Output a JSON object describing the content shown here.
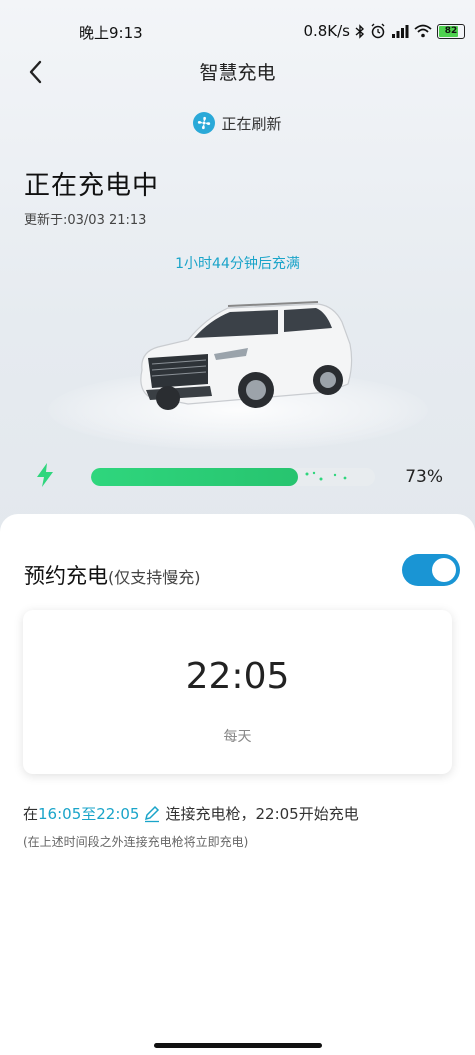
{
  "status_bar": {
    "time": "晚上9:13",
    "network_speed": "0.8K/s",
    "battery_level": "82",
    "battery_color": "#4fd14f",
    "icons": [
      "bluetooth-icon",
      "alarm-icon",
      "signal-icon",
      "wifi-icon",
      "battery-icon"
    ]
  },
  "header": {
    "title": "智慧充电",
    "back_icon": "chevron-left-icon"
  },
  "refresh": {
    "label": "正在刷新",
    "icon": "fan-icon"
  },
  "charge": {
    "status": "正在充电中",
    "updated": "更新于:03/03 21:13",
    "remaining": "1小时44分钟后充满",
    "percent_label": "73%",
    "level": 0.73,
    "accent": "#2fd67d"
  },
  "reservation": {
    "title": "预约充电",
    "subtitle": "(仅支持慢充)",
    "enabled": true,
    "time": "22:05",
    "repeat": "每天",
    "window_prefix": "在",
    "window_range": "16:05至22:05",
    "window_suffix": "连接充电枪，22:05开始充电",
    "note": "(在上述时间段之外连接充电枪将立即充电)",
    "accent": "#1aa4c9"
  }
}
